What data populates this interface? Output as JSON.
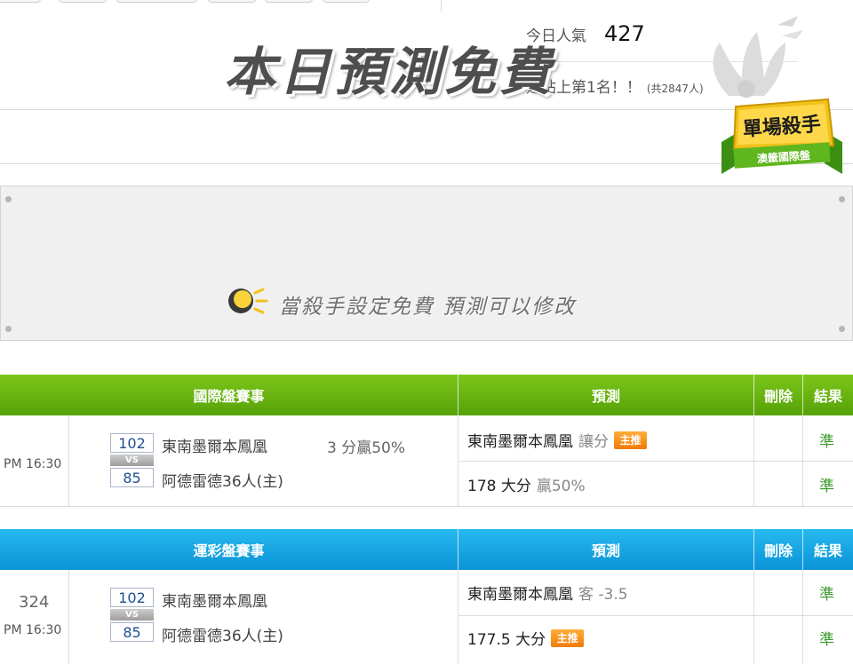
{
  "popularity": {
    "today_label": "今日人氣",
    "today_count": "427",
    "rank_text": "是站上第1名！！",
    "total_text": "(共2847人)"
  },
  "badge": {
    "title": "單場殺手",
    "subtitle": "澳籤國際盤"
  },
  "banner": {
    "title": "本日預測免費",
    "subtitle": "當殺手設定免費 預測可以修改"
  },
  "intl_table": {
    "header": {
      "event": "國際盤賽事",
      "prediction": "預測",
      "delete": "刪除",
      "result": "結果"
    },
    "game": {
      "time": "PM 16:30",
      "away_score": "102",
      "home_score": "85",
      "vs": "VS",
      "away_team": "東南墨爾本鳳凰",
      "home_team": "阿德雷德36人(主)",
      "handicap": "3 分贏50%"
    },
    "predictions": [
      {
        "main": "東南墨爾本鳳凰",
        "extra": "讓分",
        "tag": "主推",
        "result": "準"
      },
      {
        "main": "178 大分",
        "extra": "贏50%",
        "tag": "",
        "result": "準"
      }
    ]
  },
  "sports_table": {
    "header": {
      "event": "運彩盤賽事",
      "prediction": "預測",
      "delete": "刪除",
      "result": "結果"
    },
    "game": {
      "id": "324",
      "time": "PM 16:30",
      "away_score": "102",
      "home_score": "85",
      "vs": "VS",
      "away_team": "東南墨爾本鳳凰",
      "home_team": "阿德雷德36人(主)"
    },
    "predictions": [
      {
        "main": "東南墨爾本鳳凰",
        "extra": "客 -3.5",
        "tag": "",
        "result": "準"
      },
      {
        "main": "177.5 大分",
        "extra": "",
        "tag": "主推",
        "result": "準"
      }
    ]
  },
  "colors": {
    "green_header": "#56a208",
    "blue_header": "#0a93d6",
    "tag_orange": "#f07b05",
    "result_green": "#3a9a2a"
  }
}
